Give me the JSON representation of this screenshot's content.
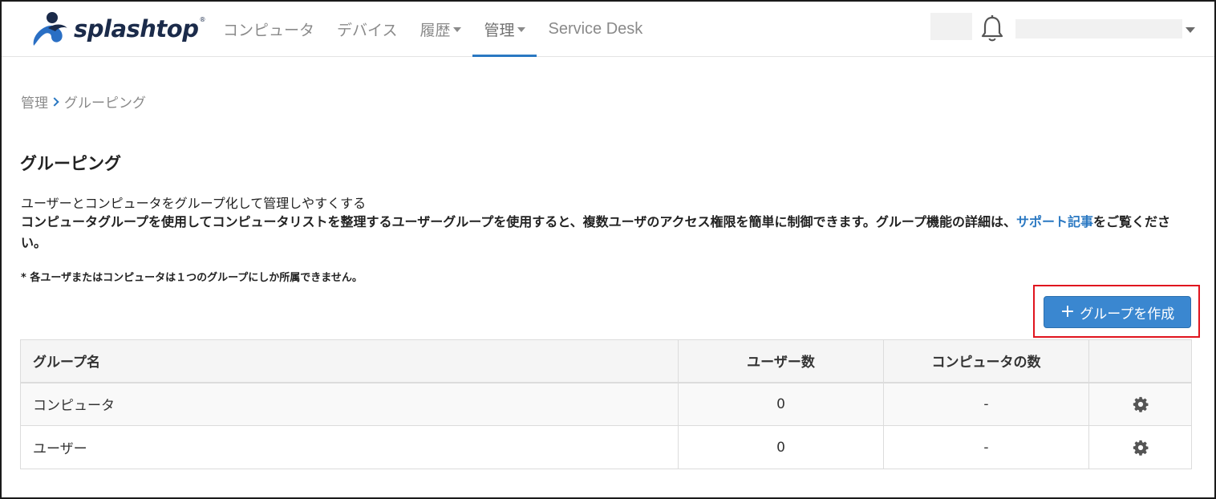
{
  "brand": {
    "name": "splashtop",
    "reg": "®"
  },
  "nav": {
    "items": [
      {
        "label": "コンピュータ",
        "dropdown": false,
        "active": false
      },
      {
        "label": "デバイス",
        "dropdown": false,
        "active": false
      },
      {
        "label": "履歴",
        "dropdown": true,
        "active": false
      },
      {
        "label": "管理",
        "dropdown": true,
        "active": true
      },
      {
        "label": "Service Desk",
        "dropdown": false,
        "active": false
      }
    ]
  },
  "header": {
    "bell_icon": "bell-icon",
    "user_menu_icon": "caret-down-icon"
  },
  "breadcrumb": {
    "parent": "管理",
    "current": "グルーピング"
  },
  "page": {
    "title": "グルーピング",
    "desc1": "ユーザーとコンピュータをグループ化して管理しやすくする",
    "desc2": "コンピュータグループを使用してコンピュータリストを整理するユーザーグループを使用すると、複数ユーザのアクセス権限を簡単に制御できます。グループ機能の詳細は、",
    "link": "サポート記事",
    "desc2_tail": "をご覧ください。",
    "note": "* 各ユーザまたはコンピュータは１つのグループにしか所属できません。"
  },
  "create_button": {
    "icon": "+",
    "label": "グループを作成"
  },
  "table": {
    "headers": [
      "グループ名",
      "ユーザー数",
      "コンピュータの数",
      ""
    ],
    "rows": [
      {
        "name": "コンピュータ",
        "users": "0",
        "computers": "-",
        "action_icon": "gear-icon"
      },
      {
        "name": "ユーザー",
        "users": "0",
        "computers": "-",
        "action_icon": "gear-icon"
      }
    ]
  },
  "colors": {
    "accent": "#2a78c2",
    "button": "#3a87d0",
    "highlight": "#e0141e",
    "brand_dark": "#1b2b4a"
  }
}
